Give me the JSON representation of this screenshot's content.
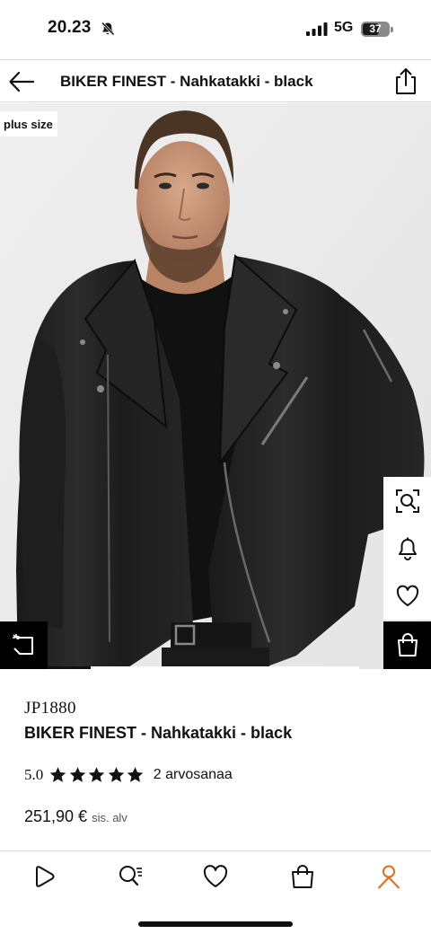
{
  "status_bar": {
    "time": "20.23",
    "network": "5G",
    "battery": "37",
    "icons": [
      "bell-mute-icon",
      "signal-icon",
      "battery-icon"
    ]
  },
  "header": {
    "title": "BIKER FINEST - Nahkatakki - black",
    "icons": [
      "back-arrow-icon",
      "share-icon"
    ]
  },
  "hero": {
    "badge": "plus size",
    "side_icons": [
      "visual-search-icon",
      "bell-icon",
      "heart-icon",
      "shopping-bag-icon"
    ],
    "left_icon": "tag-icon"
  },
  "product": {
    "brand": "JP1880",
    "name": "BIKER FINEST - Nahkatakki - black",
    "rating_value": "5.0",
    "stars": 5,
    "rating_count": "2 arvosanaa",
    "price": "251,90 €",
    "vat_note": "sis. alv"
  },
  "bottom_nav": {
    "items": [
      "play-icon",
      "search-list-icon",
      "heart-icon",
      "bag-icon",
      "user-icon"
    ],
    "active_color": "#e86a1e"
  }
}
